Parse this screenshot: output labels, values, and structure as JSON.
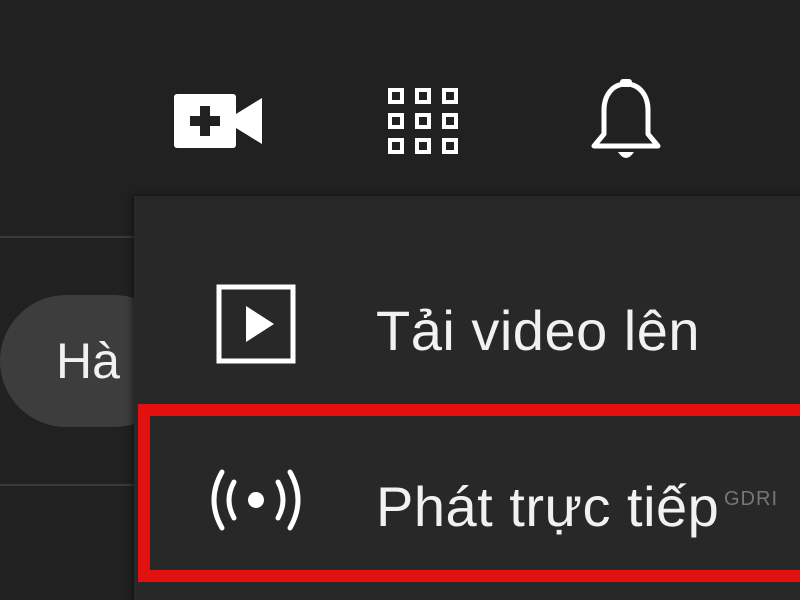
{
  "topbar": {
    "icons": [
      "create-video-icon",
      "apps-grid-icon",
      "bell-icon"
    ]
  },
  "background": {
    "chip_label": "Hà"
  },
  "menu": {
    "items": [
      {
        "label": "Tải video lên",
        "icon": "upload-video-icon"
      },
      {
        "label": "Phát trực tiếp",
        "icon": "live-broadcast-icon"
      }
    ]
  },
  "annotation": {
    "highlight_color": "#e3100f"
  },
  "watermark": "GDRI",
  "colors": {
    "background": "#212121",
    "menu": "#282828",
    "text": "#f1f1f1",
    "chip": "#3d3d3d"
  }
}
